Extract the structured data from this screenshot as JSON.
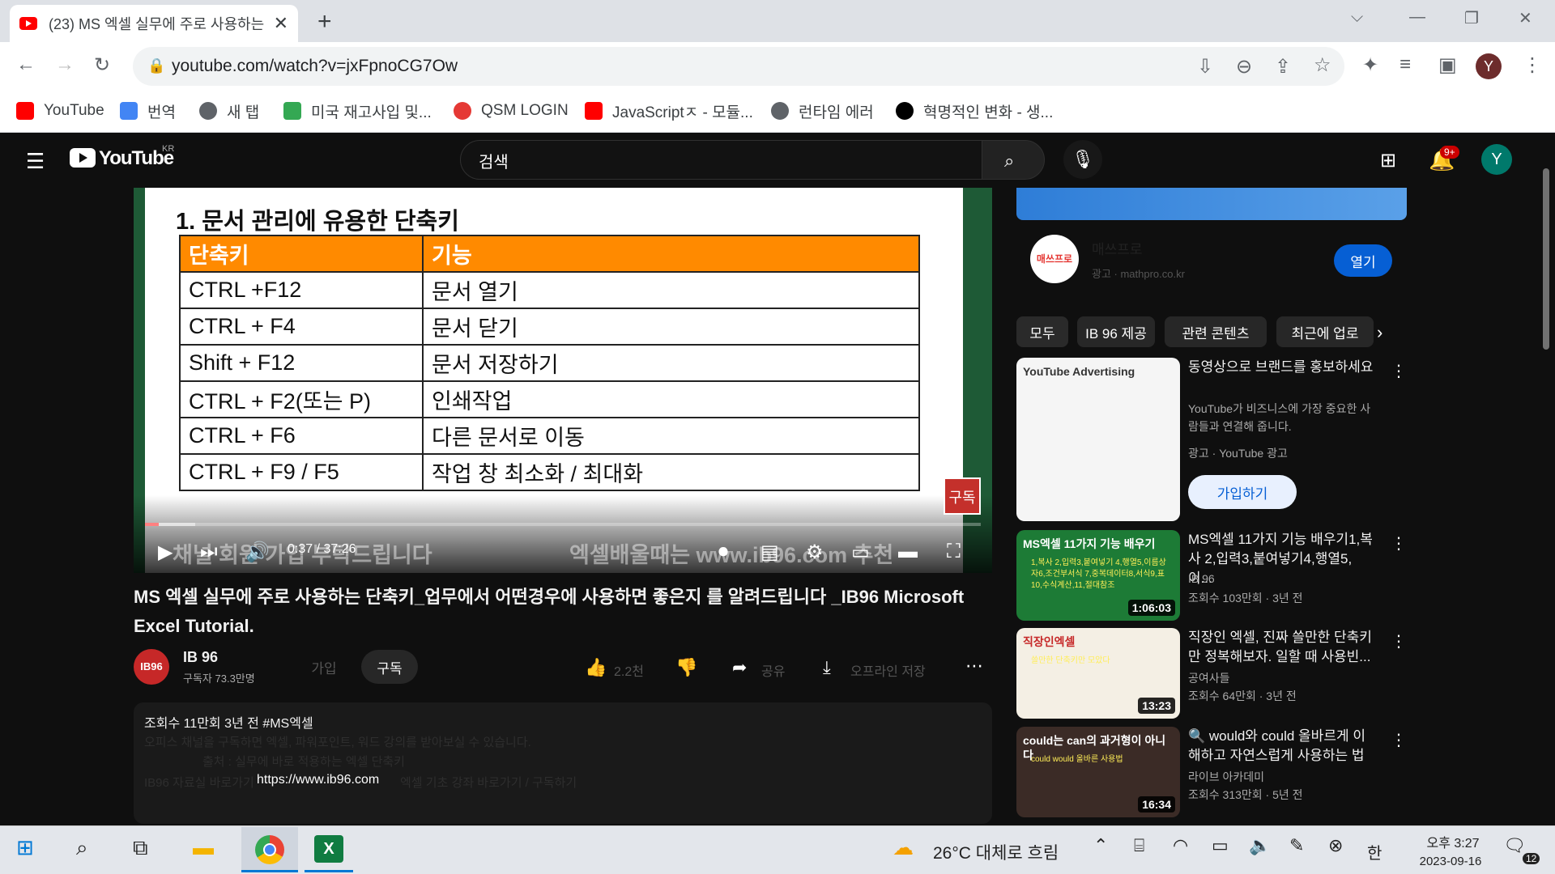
{
  "browser": {
    "tab_title": "(23) MS 엑셀 실무에 주로 사용하는",
    "url": "youtube.com/watch?v=jxFpnoCG7Ow",
    "bookmarks": [
      {
        "label": "YouTube",
        "icon": "youtube-icon",
        "color": "#ff0000"
      },
      {
        "label": "번역",
        "icon": "translate-icon",
        "color": "#4285f4"
      },
      {
        "label": "새 탭",
        "icon": "globe-icon",
        "color": "#5f6368"
      },
      {
        "label": "미국 재고사입 및...",
        "icon": "store-icon",
        "color": "#34a853"
      },
      {
        "label": "QSM LOGIN",
        "icon": "qsm-icon",
        "color": "#e53935"
      },
      {
        "label": "JavaScriptㅈ - 모듈...",
        "icon": "youtube-icon",
        "color": "#ff0000"
      },
      {
        "label": "런타임 에러",
        "icon": "globe-icon",
        "color": "#5f6368"
      },
      {
        "label": "혁명적인 변화 - 생...",
        "icon": "circle-icon",
        "color": "#000000"
      }
    ],
    "profile_initial": "Y"
  },
  "youtube": {
    "logo_region": "KR",
    "search_placeholder": "검색",
    "notif_count": "9+",
    "avatar": "Y",
    "player": {
      "slide_title": "1. 문서 관리에 유용한 단축키",
      "table_headers": [
        "단축키",
        "기능"
      ],
      "table_rows": [
        [
          "CTRL +F12",
          "문서 열기"
        ],
        [
          "CTRL + F4",
          "문서 닫기"
        ],
        [
          "Shift + F12",
          "문서 저장하기"
        ],
        [
          "CTRL + F2(또는 P)",
          "인쇄작업"
        ],
        [
          "CTRL + F6",
          "다른 문서로 이동"
        ],
        [
          "CTRL + F9 / F5",
          "작업 창 최소화 / 최대화"
        ]
      ],
      "subscribe_mark": "구독",
      "time": "0:37 / 37:26",
      "progress": 0.016,
      "buffered": 0.06,
      "subtitle_left": "채널 회원 가입 부탁드립니다",
      "subtitle_right": "엑셀배울때는 www.ib96.com 추천"
    },
    "video_title": "MS 엑셀 실무에 주로 사용하는 단축키_업무에서 어떤경우에 사용하면 좋은지 를 알려드립니다 _IB96 Microsoft Excel Tutorial.",
    "channel": {
      "name": "IB 96",
      "subs": "구독자 73.3만명",
      "logo": "IB96",
      "join": "가입",
      "subscribe": "구독"
    },
    "actions": {
      "likes": "2.2천",
      "share": "공유",
      "download": "오프라인 저장"
    },
    "description": {
      "meta": "조회수 11만회  3년 전  #MS엑셀",
      "line1": "오피스 채널을 구독하면 엑셀, 파워포인트, 워드 강의를 받아보실 수 있습니다.",
      "line2": "출처 : 실무에 바로 적용하는 엑셀 단축키",
      "link": "https://www.ib96.com",
      "line3_left": "IB96 자료실 바로가기",
      "line3_right": "엑셀 기초 강좌 바로가기 / 구독하기"
    },
    "ad": {
      "name": "매쓰프로",
      "label": "광고 · mathpro.co.kr",
      "open": "열기",
      "logo": "매쓰프로"
    },
    "chips": [
      "모두",
      "IB 96 제공",
      "관련 콘텐츠",
      "최근에 업로"
    ],
    "recommendations": [
      {
        "title": "동영상으로 브랜드를 홍보하세요",
        "desc": "YouTube가 비즈니스에 가장 중요한 사람들과 연결해 줍니다.",
        "channel": "광고 · YouTube 광고",
        "cta": "가입하기",
        "thumb_label": "YouTube Advertising",
        "kind": "ad"
      },
      {
        "title": "MS엑셀 11가지 기능 배우기1,복사 2,입력3,붙여넣기4,행열5,이...",
        "channel": "IB 96",
        "meta": "조회수 103만회 · 3년 전",
        "duration": "1:06:03",
        "thumb_label": "MS엑셀 11가지 기능 배우기",
        "thumb_sub": "1,복사 2,입력3,붙여넣기 4,행열5,이름상자6,조건부서식 7,중복데이터8,서식9,표 10,수식계산,11,절대참조"
      },
      {
        "title": "직장인 엑셀, 진짜 쓸만한 단축키만 정복해보자. 일할 때 사용빈...",
        "channel": "공여사들",
        "meta": "조회수 64만회 · 3년 전",
        "duration": "13:23",
        "thumb_label": "직장인엑셀",
        "thumb_sub": "쓸만한 단축키만 모았다"
      },
      {
        "title": "🔍 would와 could 올바르게 이해하고 자연스럽게 사용하는 법",
        "channel": "라이브 아카데미",
        "meta": "조회수 313만회 · 5년 전",
        "duration": "16:34",
        "thumb_label": "could는 can의 과거형이 아니다",
        "thumb_sub": "could would 올바른 사용법"
      }
    ]
  },
  "taskbar": {
    "weather": "26°C  대체로 흐림",
    "ime": "한",
    "time": "오후 3:27",
    "date": "2023-09-16",
    "notifications": "12"
  }
}
